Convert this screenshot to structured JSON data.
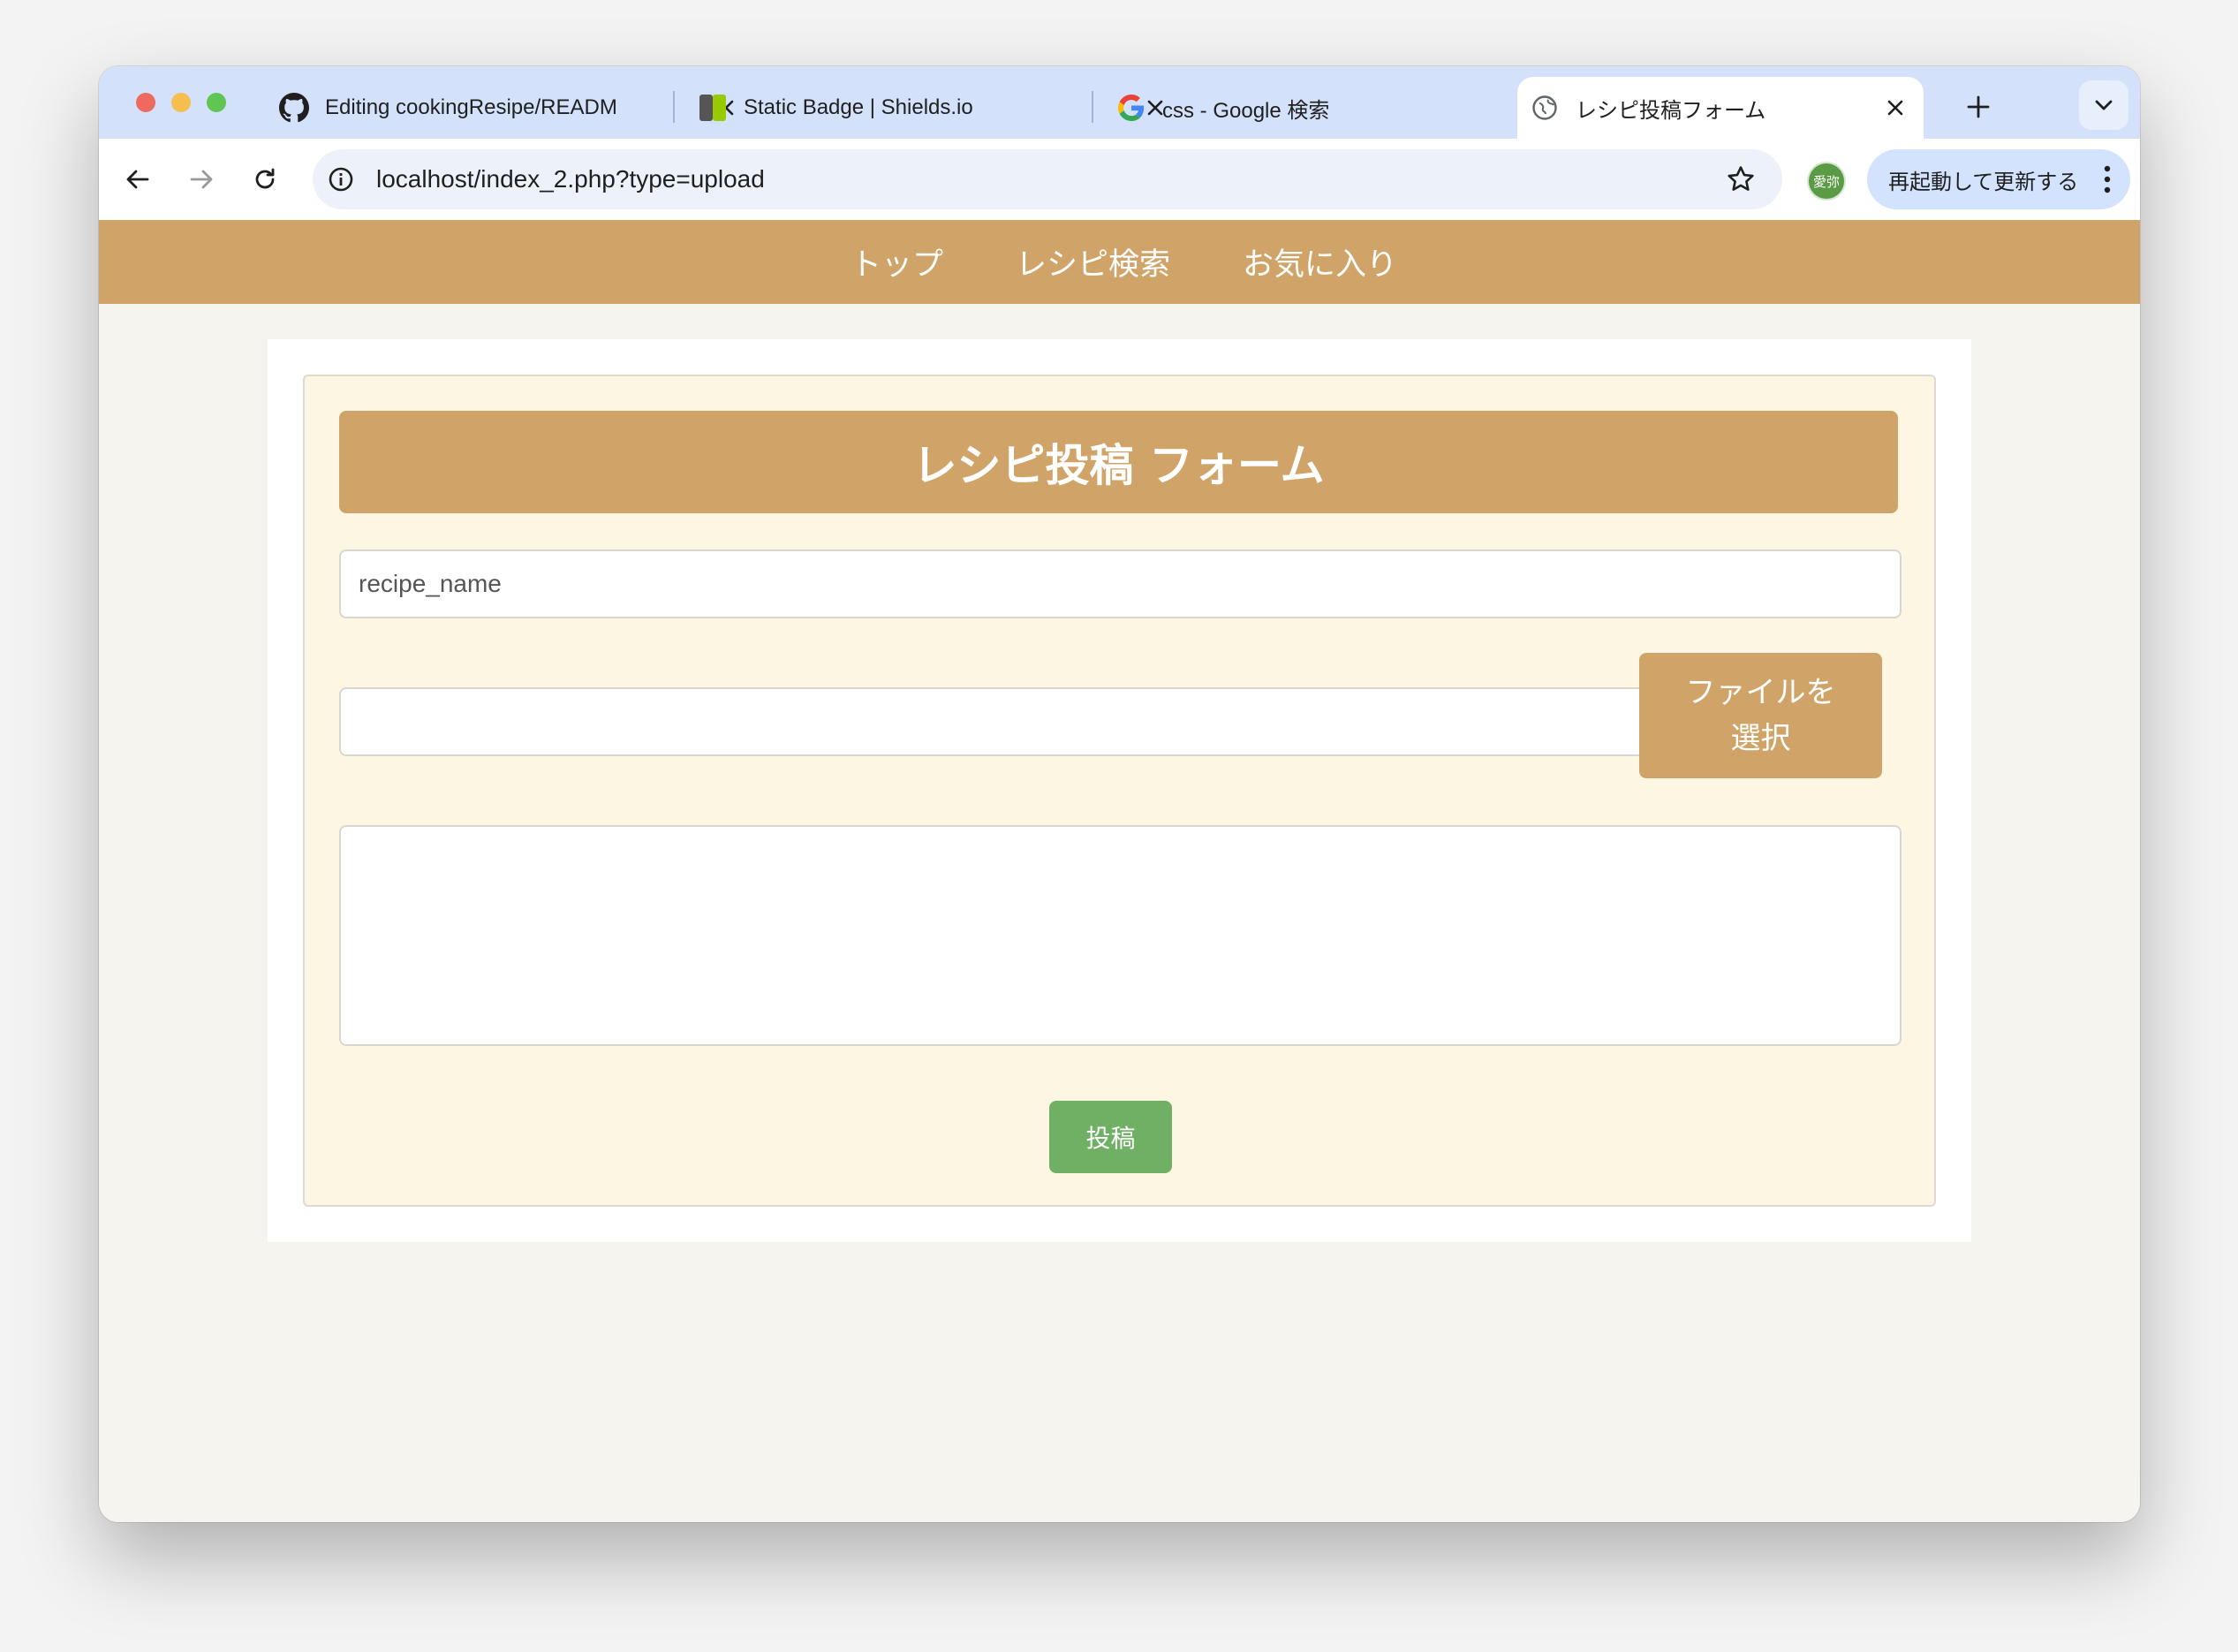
{
  "browser": {
    "tabs": [
      {
        "title": "Editing cookingResipe/READM",
        "icon": "github-icon"
      },
      {
        "title": "Static Badge | Shields.io",
        "icon": "shields-icon"
      },
      {
        "title": "css - Google 検索",
        "icon": "google-icon"
      },
      {
        "title": "レシピ投稿フォーム",
        "icon": "globe-icon",
        "active": true
      }
    ],
    "url": "localhost/index_2.php?type=upload",
    "profile_avatar": "愛弥",
    "update_button": "再起動して更新する"
  },
  "site_nav": {
    "items": [
      "トップ",
      "レシピ検索",
      "お気に入り"
    ]
  },
  "form": {
    "title": "レシピ投稿 フォーム",
    "recipe_name_placeholder": "recipe_name",
    "file_button": "ファイルを選択",
    "submit": "投稿"
  },
  "colors": {
    "accent": "#d0a468",
    "form_background": "#fdf6e3",
    "submit": "#6fb065",
    "page_background": "#f5f4ef"
  }
}
